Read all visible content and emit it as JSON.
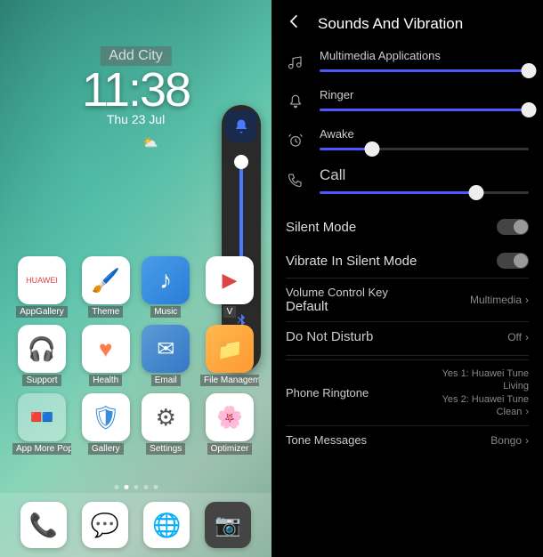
{
  "homescreen": {
    "add_city": "Add City",
    "clock_time": "11:38",
    "clock_date": "Thu 23 Jul",
    "apps": [
      {
        "label": "AppGallery",
        "sub": "HUAWEI"
      },
      {
        "label": "Theme"
      },
      {
        "label": "Music"
      },
      {
        "label": "V"
      },
      {
        "label": "Support"
      },
      {
        "label": "Health"
      },
      {
        "label": "Email"
      },
      {
        "label": "File Management"
      },
      {
        "label": "App More Popol"
      },
      {
        "label": "Gallery"
      },
      {
        "label": "Settings"
      },
      {
        "label": "Optimizer"
      }
    ],
    "dock": [
      "Phone",
      "Messages",
      "Browser",
      "Camera"
    ]
  },
  "settings": {
    "title": "Sounds And Vibration",
    "sliders": [
      {
        "label": "Multimedia Applications",
        "value": 100
      },
      {
        "label": "Ringer",
        "value": 100
      },
      {
        "label": "Awake",
        "value": 25
      },
      {
        "label": "Call",
        "value": 75
      }
    ],
    "toggles": [
      {
        "label": "Silent Mode",
        "on": false
      },
      {
        "label": "Vibrate In Silent Mode",
        "on": false
      }
    ],
    "volume_key_label": "Volume Control Key",
    "volume_key_sub": "Default",
    "volume_key_value": "Multimedia",
    "dnd_label": "Do Not Disturb",
    "dnd_value": "Off",
    "ringtone_label": "Phone Ringtone",
    "ringtone_value": "Yes 1: Huawei Tune\nLiving\nYes 2: Huawei Tune\nClean",
    "tone_msg_label": "Tone Messages",
    "tone_msg_value": "Bongo"
  }
}
